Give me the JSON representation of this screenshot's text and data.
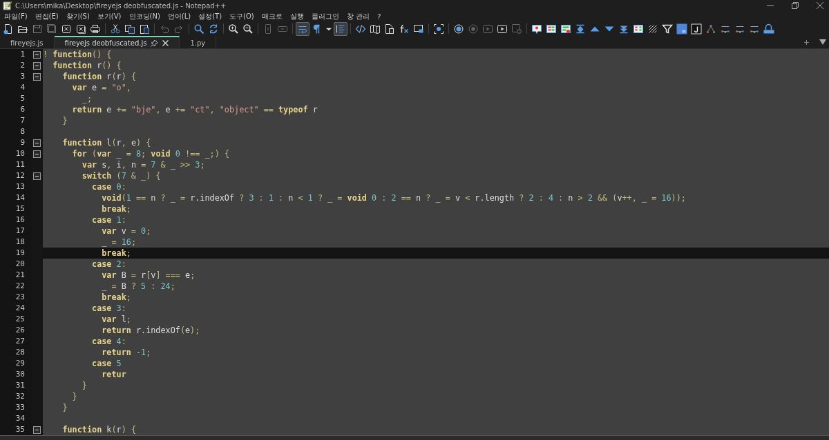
{
  "window": {
    "title": "C:\\Users\\mika\\Desktop\\fireyejs deobfuscated.js - Notepad++"
  },
  "menu": [
    "파일(F)",
    "편집(E)",
    "찾기(S)",
    "보기(V)",
    "인코딩(N)",
    "언어(L)",
    "설정(T)",
    "도구(O)",
    "매크로",
    "실행",
    "플러그인",
    "창 관리",
    "?"
  ],
  "toolbar": [
    {
      "icons": [
        {
          "kind": "new",
          "pressed": false
        },
        {
          "kind": "open",
          "pressed": false
        },
        {
          "kind": "save",
          "pressed": false
        },
        {
          "kind": "saveall",
          "pressed": false
        },
        {
          "kind": "close",
          "pressed": false
        },
        {
          "kind": "closeall",
          "pressed": false
        },
        {
          "kind": "print",
          "pressed": false
        }
      ]
    },
    {
      "icons": [
        {
          "kind": "cut",
          "pressed": false
        },
        {
          "kind": "copy",
          "pressed": false
        },
        {
          "kind": "paste",
          "pressed": false
        }
      ]
    },
    {
      "icons": [
        {
          "kind": "undo",
          "pressed": false
        },
        {
          "kind": "redo",
          "pressed": false
        }
      ]
    },
    {
      "icons": [
        {
          "kind": "find",
          "pressed": false
        },
        {
          "kind": "replace",
          "pressed": false
        }
      ]
    },
    {
      "icons": [
        {
          "kind": "zoomin",
          "pressed": false
        },
        {
          "kind": "zoomout",
          "pressed": false
        }
      ]
    },
    {
      "icons": [
        {
          "kind": "syncv",
          "pressed": false
        },
        {
          "kind": "synch",
          "pressed": false
        }
      ]
    },
    {
      "icons": [
        {
          "kind": "wrap",
          "pressed": true
        },
        {
          "kind": "pilcrow",
          "pressed": false
        },
        {
          "kind": "caret",
          "pressed": false
        },
        {
          "kind": "indent",
          "pressed": true
        }
      ]
    },
    {
      "icons": [
        {
          "kind": "tag",
          "pressed": false
        },
        {
          "kind": "map",
          "pressed": false
        },
        {
          "kind": "doc",
          "pressed": false
        },
        {
          "kind": "fx",
          "pressed": false
        },
        {
          "kind": "monitor",
          "pressed": false
        }
      ]
    },
    {
      "icons": [
        {
          "kind": "focus",
          "pressed": false
        }
      ]
    },
    {
      "icons": [
        {
          "kind": "record",
          "pressed": false
        },
        {
          "kind": "stop",
          "pressed": false
        },
        {
          "kind": "play",
          "pressed": false
        },
        {
          "kind": "playmulti",
          "pressed": false
        },
        {
          "kind": "savemacro",
          "pressed": false
        }
      ]
    },
    {
      "icons": [
        {
          "kind": "bookmark",
          "pressed": false
        },
        {
          "kind": "compare",
          "pressed": false
        },
        {
          "kind": "compareclear",
          "pressed": false
        },
        {
          "kind": "first",
          "pressed": false
        },
        {
          "kind": "up",
          "pressed": false
        },
        {
          "kind": "down",
          "pressed": false
        },
        {
          "kind": "last",
          "pressed": false
        },
        {
          "kind": "panel",
          "pressed": false
        },
        {
          "kind": "pattern",
          "pressed": false
        },
        {
          "kind": "filter",
          "pressed": false
        },
        {
          "kind": "js",
          "pressed": false
        },
        {
          "kind": "jbox",
          "pressed": false
        },
        {
          "kind": "tree",
          "pressed": false
        },
        {
          "kind": "nodes",
          "pressed": false
        },
        {
          "kind": "nodes",
          "pressed": false
        },
        {
          "kind": "nodes",
          "pressed": false
        },
        {
          "kind": "json",
          "pressed": false
        }
      ]
    }
  ],
  "tabs": [
    {
      "label": "fireyejs.js",
      "selected": false
    },
    {
      "label": "fireyejs deobfuscated.js",
      "selected": true
    },
    {
      "label": "1.py",
      "selected": false
    }
  ],
  "lines": [
    {
      "number": "1",
      "fold": true,
      "current": false,
      "tokens": [
        {
          "kind": "o",
          "text": "! "
        },
        {
          "kind": "k",
          "text": "function"
        },
        {
          "kind": "o",
          "text": "() {"
        }
      ]
    },
    {
      "number": "2",
      "fold": true,
      "current": false,
      "tokens": [
        {
          "kind": "k",
          "text": "  function"
        },
        {
          "kind": "t",
          "text": " r"
        },
        {
          "kind": "o",
          "text": "() {"
        }
      ]
    },
    {
      "number": "3",
      "fold": true,
      "current": false,
      "tokens": [
        {
          "kind": "k",
          "text": "    function"
        },
        {
          "kind": "t",
          "text": " r"
        },
        {
          "kind": "o",
          "text": "("
        },
        {
          "kind": "t",
          "text": "r"
        },
        {
          "kind": "o",
          "text": ") {"
        }
      ]
    },
    {
      "number": "4",
      "fold": false,
      "current": false,
      "tokens": [
        {
          "kind": "k",
          "text": "      var"
        },
        {
          "kind": "t",
          "text": " e "
        },
        {
          "kind": "o",
          "text": "= "
        },
        {
          "kind": "s",
          "text": "\"o\""
        },
        {
          "kind": "o",
          "text": ","
        }
      ]
    },
    {
      "number": "5",
      "fold": false,
      "current": false,
      "tokens": [
        {
          "kind": "t",
          "text": "        _"
        },
        {
          "kind": "o",
          "text": ";"
        }
      ]
    },
    {
      "number": "6",
      "fold": false,
      "current": false,
      "tokens": [
        {
          "kind": "k",
          "text": "      return"
        },
        {
          "kind": "t",
          "text": " e "
        },
        {
          "kind": "o",
          "text": "+= "
        },
        {
          "kind": "s",
          "text": "\"bje\""
        },
        {
          "kind": "o",
          "text": ", "
        },
        {
          "kind": "t",
          "text": "e "
        },
        {
          "kind": "o",
          "text": "+= "
        },
        {
          "kind": "s",
          "text": "\"ct\""
        },
        {
          "kind": "o",
          "text": ", "
        },
        {
          "kind": "s",
          "text": "\"object\""
        },
        {
          "kind": "o",
          "text": " == "
        },
        {
          "kind": "k",
          "text": "typeof"
        },
        {
          "kind": "t",
          "text": " r"
        }
      ]
    },
    {
      "number": "7",
      "fold": false,
      "current": false,
      "tokens": [
        {
          "kind": "o",
          "text": "    }"
        }
      ]
    },
    {
      "number": "8",
      "fold": false,
      "current": false
    },
    {
      "number": "9",
      "fold": true,
      "current": false,
      "tokens": [
        {
          "kind": "k",
          "text": "    function"
        },
        {
          "kind": "t",
          "text": " l"
        },
        {
          "kind": "o",
          "text": "("
        },
        {
          "kind": "t",
          "text": "r"
        },
        {
          "kind": "o",
          "text": ", "
        },
        {
          "kind": "t",
          "text": "e"
        },
        {
          "kind": "o",
          "text": ") {"
        }
      ]
    },
    {
      "number": "10",
      "fold": true,
      "current": false,
      "tokens": [
        {
          "kind": "k",
          "text": "      for"
        },
        {
          "kind": "o",
          "text": " ("
        },
        {
          "kind": "k",
          "text": "var"
        },
        {
          "kind": "t",
          "text": " _ "
        },
        {
          "kind": "o",
          "text": "= "
        },
        {
          "kind": "n",
          "text": "8"
        },
        {
          "kind": "o",
          "text": "; "
        },
        {
          "kind": "k",
          "text": "void"
        },
        {
          "kind": "n",
          "text": " 0"
        },
        {
          "kind": "o",
          "text": " !== "
        },
        {
          "kind": "t",
          "text": "_"
        },
        {
          "kind": "o",
          "text": ";) {"
        }
      ]
    },
    {
      "number": "11",
      "fold": false,
      "current": false,
      "tokens": [
        {
          "kind": "k",
          "text": "        var"
        },
        {
          "kind": "t",
          "text": " s"
        },
        {
          "kind": "o",
          "text": ", "
        },
        {
          "kind": "t",
          "text": "i"
        },
        {
          "kind": "o",
          "text": ", "
        },
        {
          "kind": "t",
          "text": "n "
        },
        {
          "kind": "o",
          "text": "= "
        },
        {
          "kind": "n",
          "text": "7"
        },
        {
          "kind": "o",
          "text": " & "
        },
        {
          "kind": "t",
          "text": "_"
        },
        {
          "kind": "o",
          "text": " >> "
        },
        {
          "kind": "n",
          "text": "3"
        },
        {
          "kind": "o",
          "text": ";"
        }
      ]
    },
    {
      "number": "12",
      "fold": true,
      "current": false,
      "tokens": [
        {
          "kind": "k",
          "text": "        switch"
        },
        {
          "kind": "o",
          "text": " ("
        },
        {
          "kind": "n",
          "text": "7"
        },
        {
          "kind": "o",
          "text": " & "
        },
        {
          "kind": "t",
          "text": "_"
        },
        {
          "kind": "o",
          "text": ") {"
        }
      ]
    },
    {
      "number": "13",
      "fold": false,
      "current": false,
      "tokens": [
        {
          "kind": "k",
          "text": "          case"
        },
        {
          "kind": "n",
          "text": " 0"
        },
        {
          "kind": "o",
          "text": ":"
        }
      ]
    },
    {
      "number": "14",
      "fold": false,
      "current": false,
      "tokens": [
        {
          "kind": "k",
          "text": "            void"
        },
        {
          "kind": "o",
          "text": "("
        },
        {
          "kind": "n",
          "text": "1"
        },
        {
          "kind": "o",
          "text": " == "
        },
        {
          "kind": "t",
          "text": "n "
        },
        {
          "kind": "o",
          "text": "? "
        },
        {
          "kind": "t",
          "text": "_ "
        },
        {
          "kind": "o",
          "text": "= "
        },
        {
          "kind": "t",
          "text": "r.indexOf "
        },
        {
          "kind": "o",
          "text": "? "
        },
        {
          "kind": "n",
          "text": "3"
        },
        {
          "kind": "o",
          "text": " : "
        },
        {
          "kind": "n",
          "text": "1"
        },
        {
          "kind": "o",
          "text": " : "
        },
        {
          "kind": "t",
          "text": "n "
        },
        {
          "kind": "o",
          "text": "< "
        },
        {
          "kind": "n",
          "text": "1"
        },
        {
          "kind": "o",
          "text": " ? "
        },
        {
          "kind": "t",
          "text": "_ "
        },
        {
          "kind": "o",
          "text": "= "
        },
        {
          "kind": "k",
          "text": "void"
        },
        {
          "kind": "n",
          "text": " 0"
        },
        {
          "kind": "o",
          "text": " : "
        },
        {
          "kind": "n",
          "text": "2"
        },
        {
          "kind": "o",
          "text": " == "
        },
        {
          "kind": "t",
          "text": "n "
        },
        {
          "kind": "o",
          "text": "? "
        },
        {
          "kind": "t",
          "text": "_ "
        },
        {
          "kind": "o",
          "text": "= "
        },
        {
          "kind": "t",
          "text": "v "
        },
        {
          "kind": "o",
          "text": "< "
        },
        {
          "kind": "t",
          "text": "r.length "
        },
        {
          "kind": "o",
          "text": "? "
        },
        {
          "kind": "n",
          "text": "2"
        },
        {
          "kind": "o",
          "text": " : "
        },
        {
          "kind": "n",
          "text": "4"
        },
        {
          "kind": "o",
          "text": " : "
        },
        {
          "kind": "t",
          "text": "n "
        },
        {
          "kind": "o",
          "text": "> "
        },
        {
          "kind": "n",
          "text": "2"
        },
        {
          "kind": "o",
          "text": " && ("
        },
        {
          "kind": "t",
          "text": "v"
        },
        {
          "kind": "o",
          "text": "++, "
        },
        {
          "kind": "t",
          "text": "_ "
        },
        {
          "kind": "o",
          "text": "= "
        },
        {
          "kind": "n",
          "text": "16"
        },
        {
          "kind": "o",
          "text": "));"
        }
      ]
    },
    {
      "number": "15",
      "fold": false,
      "current": false,
      "tokens": [
        {
          "kind": "k",
          "text": "            break"
        },
        {
          "kind": "o",
          "text": ";"
        }
      ]
    },
    {
      "number": "16",
      "fold": false,
      "current": false,
      "tokens": [
        {
          "kind": "k",
          "text": "          case"
        },
        {
          "kind": "n",
          "text": " 1"
        },
        {
          "kind": "o",
          "text": ":"
        }
      ]
    },
    {
      "number": "17",
      "fold": false,
      "current": false,
      "tokens": [
        {
          "kind": "k",
          "text": "            var"
        },
        {
          "kind": "t",
          "text": " v "
        },
        {
          "kind": "o",
          "text": "= "
        },
        {
          "kind": "n",
          "text": "0"
        },
        {
          "kind": "o",
          "text": ";"
        }
      ]
    },
    {
      "number": "18",
      "fold": false,
      "current": false,
      "tokens": [
        {
          "kind": "t",
          "text": "            _ "
        },
        {
          "kind": "o",
          "text": "= "
        },
        {
          "kind": "n",
          "text": "16"
        },
        {
          "kind": "o",
          "text": ";"
        }
      ]
    },
    {
      "number": "19",
      "fold": false,
      "current": true,
      "tokens": [
        {
          "kind": "k",
          "text": "            break"
        },
        {
          "kind": "o",
          "text": ";"
        }
      ]
    },
    {
      "number": "20",
      "fold": false,
      "current": false,
      "tokens": [
        {
          "kind": "k",
          "text": "          case"
        },
        {
          "kind": "n",
          "text": " 2"
        },
        {
          "kind": "o",
          "text": ":"
        }
      ]
    },
    {
      "number": "21",
      "fold": false,
      "current": false,
      "tokens": [
        {
          "kind": "k",
          "text": "            var"
        },
        {
          "kind": "t",
          "text": " B "
        },
        {
          "kind": "o",
          "text": "= "
        },
        {
          "kind": "t",
          "text": "r"
        },
        {
          "kind": "o",
          "text": "["
        },
        {
          "kind": "t",
          "text": "v"
        },
        {
          "kind": "o",
          "text": "] === "
        },
        {
          "kind": "t",
          "text": "e"
        },
        {
          "kind": "o",
          "text": ";"
        }
      ]
    },
    {
      "number": "22",
      "fold": false,
      "current": false,
      "tokens": [
        {
          "kind": "t",
          "text": "            _ "
        },
        {
          "kind": "o",
          "text": "= "
        },
        {
          "kind": "t",
          "text": "B "
        },
        {
          "kind": "o",
          "text": "? "
        },
        {
          "kind": "n",
          "text": "5"
        },
        {
          "kind": "o",
          "text": " : "
        },
        {
          "kind": "n",
          "text": "24"
        },
        {
          "kind": "o",
          "text": ";"
        }
      ]
    },
    {
      "number": "23",
      "fold": false,
      "current": false,
      "tokens": [
        {
          "kind": "k",
          "text": "            break"
        },
        {
          "kind": "o",
          "text": ";"
        }
      ]
    },
    {
      "number": "24",
      "fold": false,
      "current": false,
      "tokens": [
        {
          "kind": "k",
          "text": "          case"
        },
        {
          "kind": "n",
          "text": " 3"
        },
        {
          "kind": "o",
          "text": ":"
        }
      ]
    },
    {
      "number": "25",
      "fold": false,
      "current": false,
      "tokens": [
        {
          "kind": "k",
          "text": "            var"
        },
        {
          "kind": "t",
          "text": " l"
        },
        {
          "kind": "o",
          "text": ";"
        }
      ]
    },
    {
      "number": "26",
      "fold": false,
      "current": false,
      "tokens": [
        {
          "kind": "k",
          "text": "            return"
        },
        {
          "kind": "t",
          "text": " r.indexOf"
        },
        {
          "kind": "o",
          "text": "("
        },
        {
          "kind": "t",
          "text": "e"
        },
        {
          "kind": "o",
          "text": ");"
        }
      ]
    },
    {
      "number": "27",
      "fold": false,
      "current": false,
      "tokens": [
        {
          "kind": "k",
          "text": "          case"
        },
        {
          "kind": "n",
          "text": " 4"
        },
        {
          "kind": "o",
          "text": ":"
        }
      ]
    },
    {
      "number": "28",
      "fold": false,
      "current": false,
      "tokens": [
        {
          "kind": "k",
          "text": "            return"
        },
        {
          "kind": "o",
          "text": " -"
        },
        {
          "kind": "n",
          "text": "1"
        },
        {
          "kind": "o",
          "text": ";"
        }
      ]
    },
    {
      "number": "29",
      "fold": false,
      "current": false,
      "tokens": [
        {
          "kind": "k",
          "text": "          case"
        },
        {
          "kind": "n",
          "text": " 5"
        }
      ]
    },
    {
      "number": "30",
      "fold": false,
      "current": false,
      "tokens": [
        {
          "kind": "k",
          "text": "            retur"
        }
      ]
    },
    {
      "number": "31",
      "fold": false,
      "current": false,
      "tokens": [
        {
          "kind": "o",
          "text": "        }"
        }
      ]
    },
    {
      "number": "32",
      "fold": false,
      "current": false,
      "tokens": [
        {
          "kind": "o",
          "text": "      }"
        }
      ]
    },
    {
      "number": "33",
      "fold": false,
      "current": false,
      "tokens": [
        {
          "kind": "o",
          "text": "    }"
        }
      ]
    },
    {
      "number": "34",
      "fold": false,
      "current": false
    },
    {
      "number": "35",
      "fold": true,
      "current": false,
      "tokens": [
        {
          "kind": "k",
          "text": "    function"
        },
        {
          "kind": "t",
          "text": " k"
        },
        {
          "kind": "o",
          "text": "("
        },
        {
          "kind": "t",
          "text": "r"
        },
        {
          "kind": "o",
          "text": ") {"
        }
      ]
    }
  ]
}
